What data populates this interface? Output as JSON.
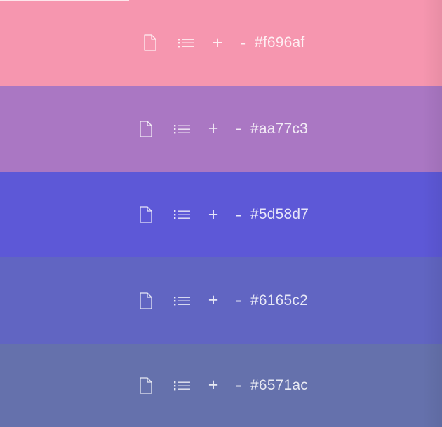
{
  "swatches": [
    {
      "color": "#f696af",
      "hex_label": "#f696af",
      "icons": [
        "document-icon",
        "list-icon"
      ],
      "plus_label": "+",
      "minus_label": "-"
    },
    {
      "color": "#aa77c3",
      "hex_label": "#aa77c3",
      "icons": [
        "document-icon",
        "list-icon"
      ],
      "plus_label": "+",
      "minus_label": "-"
    },
    {
      "color": "#5d58d7",
      "hex_label": "#5d58d7",
      "icons": [
        "document-icon",
        "list-icon"
      ],
      "plus_label": "+",
      "minus_label": "-"
    },
    {
      "color": "#6165c2",
      "hex_label": "#6165c2",
      "icons": [
        "document-icon",
        "list-icon"
      ],
      "plus_label": "+",
      "minus_label": "-"
    },
    {
      "color": "#6571ac",
      "hex_label": "#6571ac",
      "icons": [
        "document-icon",
        "list-icon"
      ],
      "plus_label": "+",
      "minus_label": "-"
    }
  ]
}
